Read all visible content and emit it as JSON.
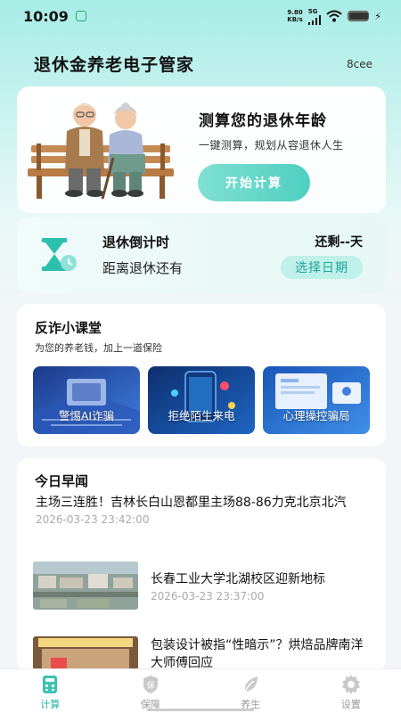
{
  "status_bar": {
    "time": "10:09",
    "net_speed_value": "9.80",
    "net_speed_unit": "KB/s",
    "net_type": "5G",
    "icons": [
      "app-notification-icon",
      "signal-icon",
      "wifi-icon",
      "battery-icon",
      "charging-icon"
    ]
  },
  "header": {
    "title": "退休金养老电子管家",
    "code": "8cee"
  },
  "hero": {
    "title": "测算您的退休年龄",
    "subtitle": "一键测算，规划从容退休人生",
    "button_label": "开始计算"
  },
  "countdown": {
    "title": "退休倒计时",
    "subtitle": "距离退休还有",
    "remaining": "还剩--天",
    "button_label": "选择日期"
  },
  "fraud": {
    "title": "反诈小课堂",
    "subtitle": "为您的养老钱，加上一道保险",
    "tiles": [
      {
        "label": "警惕AI诈骗"
      },
      {
        "label": "拒绝陌生来电"
      },
      {
        "label": "心理操控骗局"
      }
    ]
  },
  "news": {
    "heading": "今日早闻",
    "items": [
      {
        "title": "主场三连胜！吉林长白山恩都里主场88-86力克北京北汽",
        "date": "2026-03-23 23:42:00"
      },
      {
        "title": "长春工业大学北湖校区迎新地标",
        "date": "2026-03-23 23:37:00"
      },
      {
        "title": "包装设计被指“性暗示”？烘焙品牌南洋大师傅回应",
        "date": ""
      }
    ]
  },
  "tabbar": {
    "tabs": [
      {
        "label": "计算",
        "icon": "calculator-icon",
        "active": true
      },
      {
        "label": "保障",
        "icon": "shield-icon",
        "active": false
      },
      {
        "label": "养生",
        "icon": "leaf-icon",
        "active": false
      },
      {
        "label": "设置",
        "icon": "gear-icon",
        "active": false
      }
    ]
  },
  "colors": {
    "accent": "#26b3a4",
    "button_gradient_start": "#7fe0d2",
    "button_gradient_end": "#4fcfc1"
  }
}
